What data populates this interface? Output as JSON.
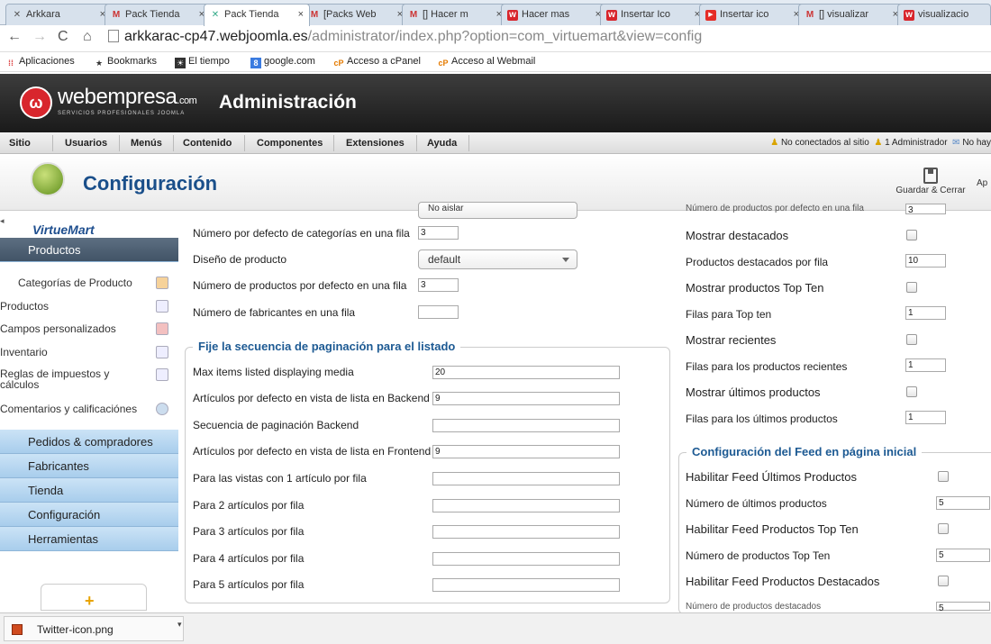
{
  "browser": {
    "tabs": [
      {
        "label": "Arkkara",
        "icon": "arkkara-icon",
        "glyph": "✕"
      },
      {
        "label": "Pack Tienda",
        "icon": "gmail-icon",
        "glyph": "M"
      },
      {
        "label": "Pack Tienda",
        "icon": "puzzle-icon",
        "glyph": "✕"
      },
      {
        "label": "[Packs Web",
        "icon": "gmail-icon",
        "glyph": "M"
      },
      {
        "label": "[] Hacer m",
        "icon": "gmail-icon",
        "glyph": "M"
      },
      {
        "label": "Hacer mas",
        "icon": "webempresa-icon",
        "glyph": "w"
      },
      {
        "label": "Insertar Ico",
        "icon": "webempresa-icon",
        "glyph": "w"
      },
      {
        "label": "Insertar ico",
        "icon": "youtube-icon",
        "glyph": "▶"
      },
      {
        "label": "[] visualizar",
        "icon": "gmail-icon",
        "glyph": "M"
      },
      {
        "label": "visualizacio",
        "icon": "webempresa-icon",
        "glyph": "w"
      }
    ],
    "url_host": "arkkarac-cp47.webjoomla.es",
    "url_path": "/administrator/index.php?option=com_virtuemart&view=config",
    "bookmarks": [
      "Aplicaciones",
      "Bookmarks",
      "El tiempo",
      "google.com",
      "Acceso a cPanel",
      "Acceso al Webmail"
    ]
  },
  "header": {
    "brand": "webempresa",
    "brand_suffix": ".com",
    "brand_tagline": "SERVICIOS PROFESIONALES JOOMLA",
    "title": "Administración"
  },
  "menu": {
    "items": [
      "Sitio",
      "Usuarios",
      "Menús",
      "Contenido",
      "Componentes",
      "Extensiones",
      "Ayuda"
    ],
    "status_visitors": "No conectados al sitio",
    "status_admins": "1 Administrador",
    "status_messages": "No hay"
  },
  "toolbar": {
    "page_title": "Configuración",
    "save_close": "Guardar & Cerrar",
    "apply": "Ap"
  },
  "sidebar": {
    "logo": "VirtueMart",
    "products_section": "Productos",
    "sub_items": [
      "Categorías de Producto",
      "Productos",
      "Campos personalizados",
      "Inventario",
      "Reglas de impuestos y cálculos",
      "Comentarios y calificaciónes"
    ],
    "sections": [
      "Pedidos & compradores",
      "Fabricantes",
      "Tienda",
      "Configuración",
      "Herramientas"
    ]
  },
  "left_form": {
    "cut_select_value": "No aislar",
    "rows_top": [
      {
        "label": "Número por defecto de categorías en una fila",
        "value": "3"
      },
      {
        "label": "Diseño de producto",
        "value": "default"
      },
      {
        "label": "Número de productos por defecto en una fila",
        "value": "3"
      },
      {
        "label": "Número de fabricantes en una fila",
        "value": ""
      }
    ],
    "pagination_legend": "Fije la secuencia de paginación para el listado",
    "pagination_rows": [
      {
        "label": "Max items listed displaying media",
        "value": "20"
      },
      {
        "label": "Artículos por defecto en vista de lista en Backend",
        "value": "9"
      },
      {
        "label": "Secuencia de paginación Backend",
        "value": ""
      },
      {
        "label": "Artículos por defecto en vista de lista en Frontend",
        "value": "9"
      },
      {
        "label": "Para las vistas con 1 artículo por fila",
        "value": ""
      },
      {
        "label": "Para 2 artículos por fila",
        "value": ""
      },
      {
        "label": "Para 3 artículos por fila",
        "value": ""
      },
      {
        "label": "Para 4 artículos por fila",
        "value": ""
      },
      {
        "label": "Para 5 artículos por fila",
        "value": ""
      }
    ]
  },
  "right_form": {
    "cut_row_label": "Número de productos por defecto en una fila",
    "cut_row_value": "3",
    "rows": [
      {
        "label": "Mostrar destacados",
        "type": "checkbox",
        "value": ""
      },
      {
        "label": "Productos destacados por fila",
        "type": "text",
        "value": "10"
      },
      {
        "label": "Mostrar productos Top Ten",
        "type": "checkbox",
        "value": ""
      },
      {
        "label": "Filas para Top ten",
        "type": "text",
        "value": "1"
      },
      {
        "label": "Mostrar recientes",
        "type": "checkbox",
        "value": ""
      },
      {
        "label": "Filas para los productos recientes",
        "type": "text",
        "value": "1"
      },
      {
        "label": "Mostrar últimos productos",
        "type": "checkbox",
        "value": ""
      },
      {
        "label": "Filas para los últimos productos",
        "type": "text",
        "value": "1"
      }
    ],
    "feed_legend": "Configuración del Feed en página inicial",
    "feed_rows": [
      {
        "label": "Habilitar Feed Últimos Productos",
        "type": "checkbox",
        "value": ""
      },
      {
        "label": "Número de últimos productos",
        "type": "text",
        "value": "5"
      },
      {
        "label": "Habilitar Feed Productos Top Ten",
        "type": "checkbox",
        "value": ""
      },
      {
        "label": "Número de productos Top Ten",
        "type": "text",
        "value": "5"
      },
      {
        "label": "Habilitar Feed Productos Destacados",
        "type": "checkbox",
        "value": ""
      }
    ],
    "feed_cut_label": "Número de productos destacados",
    "feed_cut_value": "5"
  },
  "download": {
    "filename": "Twitter-icon.png"
  }
}
